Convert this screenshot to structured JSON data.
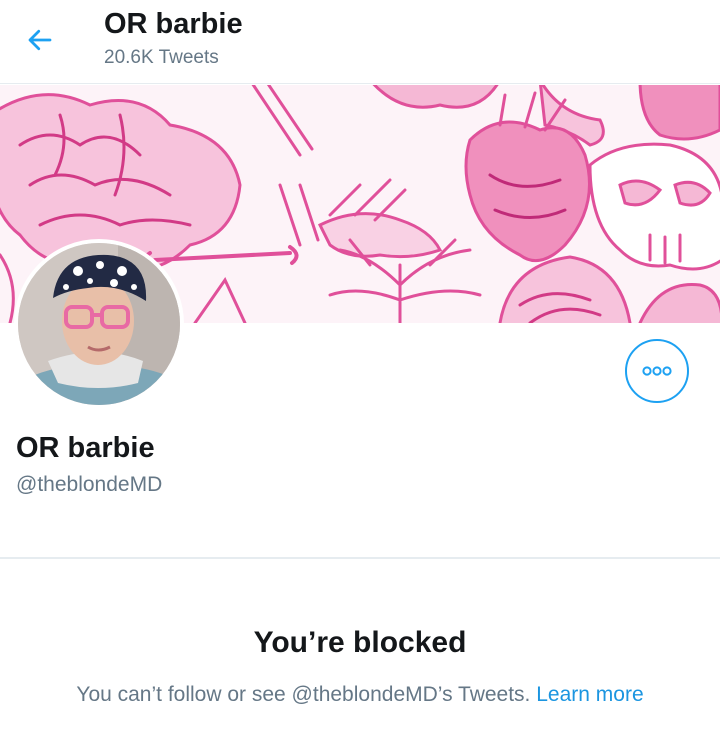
{
  "header": {
    "title": "OR barbie",
    "tweet_count": "20.6K Tweets"
  },
  "icons": {
    "back": "arrow-left-icon",
    "more": "more-horizontal-icon"
  },
  "profile": {
    "name": "OR barbie",
    "handle": "@theblondeMD"
  },
  "blocked": {
    "title": "You’re blocked",
    "message": "You can’t follow or see @theblondeMD’s Tweets.",
    "link": "Learn more"
  },
  "colors": {
    "accent": "#1da1f2",
    "secondary_text": "#657786",
    "banner_ink": "#e0509a"
  }
}
